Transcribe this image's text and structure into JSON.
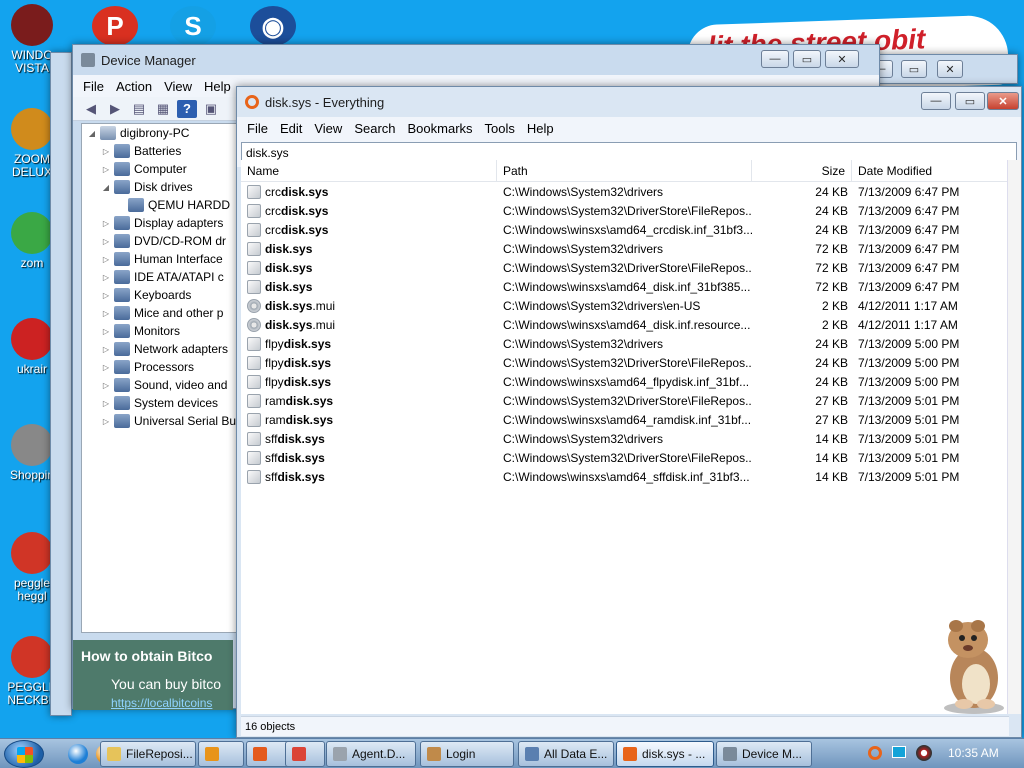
{
  "desktop": {
    "icons": [
      {
        "label": "WINDO\nVISTA",
        "icon": "disc-icon",
        "color": "#7a1c1c"
      },
      {
        "label": "ZOOM\nDELUX",
        "icon": "zoom-icon",
        "color": "#d08b1c"
      },
      {
        "label": "zom",
        "icon": "flower-icon",
        "color": "#3aa845"
      },
      {
        "label": "ukrair",
        "icon": "radiation-icon",
        "color": "#c22"
      },
      {
        "label": "Shoppin",
        "icon": "flash-icon",
        "color": "#888"
      },
      {
        "label": "peggle\nheggl",
        "icon": "peggle-icon",
        "color": "#d03526"
      },
      {
        "label": "PEGGLE\nNECKBE",
        "icon": "peggle-icon",
        "color": "#d03526"
      }
    ],
    "top_icons": [
      {
        "glyph": "P",
        "color": "#d93020"
      },
      {
        "glyph": "S",
        "color": "#14a0e5"
      },
      {
        "glyph": "◉",
        "color": "#1c4e9a"
      }
    ],
    "paper_text": "lit the street obit"
  },
  "device_manager": {
    "title": "Device Manager",
    "menu": [
      "File",
      "Action",
      "View",
      "Help"
    ],
    "tree": [
      {
        "label": "digibrony-PC",
        "arrow": "◢",
        "indent": 0
      },
      {
        "label": "Batteries",
        "arrow": "▷",
        "indent": 1
      },
      {
        "label": "Computer",
        "arrow": "▷",
        "indent": 1
      },
      {
        "label": "Disk drives",
        "arrow": "◢",
        "indent": 1
      },
      {
        "label": "QEMU HARDD",
        "arrow": "",
        "indent": 2
      },
      {
        "label": "Display adapters",
        "arrow": "▷",
        "indent": 1
      },
      {
        "label": "DVD/CD-ROM dr",
        "arrow": "▷",
        "indent": 1
      },
      {
        "label": "Human Interface",
        "arrow": "▷",
        "indent": 1
      },
      {
        "label": "IDE ATA/ATAPI c",
        "arrow": "▷",
        "indent": 1
      },
      {
        "label": "Keyboards",
        "arrow": "▷",
        "indent": 1
      },
      {
        "label": "Mice and other p",
        "arrow": "▷",
        "indent": 1
      },
      {
        "label": "Monitors",
        "arrow": "▷",
        "indent": 1
      },
      {
        "label": "Network adapters",
        "arrow": "▷",
        "indent": 1
      },
      {
        "label": "Processors",
        "arrow": "▷",
        "indent": 1
      },
      {
        "label": "Sound, video and",
        "arrow": "▷",
        "indent": 1
      },
      {
        "label": "System devices",
        "arrow": "▷",
        "indent": 1
      },
      {
        "label": "Universal Serial Bu",
        "arrow": "▷",
        "indent": 1
      }
    ],
    "bottom_heading": "How to obtain Bitco",
    "bottom_text": "You can buy bitco",
    "bottom_link": "https://localbitcoins"
  },
  "everything": {
    "title": "disk.sys - Everything",
    "menu": [
      "File",
      "Edit",
      "View",
      "Search",
      "Bookmarks",
      "Tools",
      "Help"
    ],
    "search_value": "disk.sys",
    "columns": {
      "name": "Name",
      "path": "Path",
      "size": "Size",
      "date": "Date Modified"
    },
    "rows": [
      {
        "pre": "crc",
        "match": "disk.sys",
        "post": "",
        "path": "C:\\Windows\\System32\\drivers",
        "size": "24 KB",
        "date": "7/13/2009 6:47 PM",
        "icon": "file"
      },
      {
        "pre": "crc",
        "match": "disk.sys",
        "post": "",
        "path": "C:\\Windows\\System32\\DriverStore\\FileRepos...",
        "size": "24 KB",
        "date": "7/13/2009 6:47 PM",
        "icon": "file"
      },
      {
        "pre": "crc",
        "match": "disk.sys",
        "post": "",
        "path": "C:\\Windows\\winsxs\\amd64_crcdisk.inf_31bf3...",
        "size": "24 KB",
        "date": "7/13/2009 6:47 PM",
        "icon": "file"
      },
      {
        "pre": "",
        "match": "disk.sys",
        "post": "",
        "path": "C:\\Windows\\System32\\drivers",
        "size": "72 KB",
        "date": "7/13/2009 6:47 PM",
        "icon": "file"
      },
      {
        "pre": "",
        "match": "disk.sys",
        "post": "",
        "path": "C:\\Windows\\System32\\DriverStore\\FileRepos...",
        "size": "72 KB",
        "date": "7/13/2009 6:47 PM",
        "icon": "file"
      },
      {
        "pre": "",
        "match": "disk.sys",
        "post": "",
        "path": "C:\\Windows\\winsxs\\amd64_disk.inf_31bf385...",
        "size": "72 KB",
        "date": "7/13/2009 6:47 PM",
        "icon": "file"
      },
      {
        "pre": "",
        "match": "disk.sys",
        "post": ".mui",
        "path": "C:\\Windows\\System32\\drivers\\en-US",
        "size": "2 KB",
        "date": "4/12/2011 1:17 AM",
        "icon": "gear"
      },
      {
        "pre": "",
        "match": "disk.sys",
        "post": ".mui",
        "path": "C:\\Windows\\winsxs\\amd64_disk.inf.resource...",
        "size": "2 KB",
        "date": "4/12/2011 1:17 AM",
        "icon": "gear"
      },
      {
        "pre": "flpy",
        "match": "disk.sys",
        "post": "",
        "path": "C:\\Windows\\System32\\drivers",
        "size": "24 KB",
        "date": "7/13/2009 5:00 PM",
        "icon": "file"
      },
      {
        "pre": "flpy",
        "match": "disk.sys",
        "post": "",
        "path": "C:\\Windows\\System32\\DriverStore\\FileRepos...",
        "size": "24 KB",
        "date": "7/13/2009 5:00 PM",
        "icon": "file"
      },
      {
        "pre": "flpy",
        "match": "disk.sys",
        "post": "",
        "path": "C:\\Windows\\winsxs\\amd64_flpydisk.inf_31bf...",
        "size": "24 KB",
        "date": "7/13/2009 5:00 PM",
        "icon": "file"
      },
      {
        "pre": "ram",
        "match": "disk.sys",
        "post": "",
        "path": "C:\\Windows\\System32\\DriverStore\\FileRepos...",
        "size": "27 KB",
        "date": "7/13/2009 5:01 PM",
        "icon": "file"
      },
      {
        "pre": "ram",
        "match": "disk.sys",
        "post": "",
        "path": "C:\\Windows\\winsxs\\amd64_ramdisk.inf_31bf...",
        "size": "27 KB",
        "date": "7/13/2009 5:01 PM",
        "icon": "file"
      },
      {
        "pre": "sff",
        "match": "disk.sys",
        "post": "",
        "path": "C:\\Windows\\System32\\drivers",
        "size": "14 KB",
        "date": "7/13/2009 5:01 PM",
        "icon": "file"
      },
      {
        "pre": "sff",
        "match": "disk.sys",
        "post": "",
        "path": "C:\\Windows\\System32\\DriverStore\\FileRepos...",
        "size": "14 KB",
        "date": "7/13/2009 5:01 PM",
        "icon": "file"
      },
      {
        "pre": "sff",
        "match": "disk.sys",
        "post": "",
        "path": "C:\\Windows\\winsxs\\amd64_sffdisk.inf_31bf3...",
        "size": "14 KB",
        "date": "7/13/2009 5:01 PM",
        "icon": "file"
      }
    ],
    "status": "16 objects"
  },
  "taskbar": {
    "quick_launch": [
      {
        "icon": "ie-icon",
        "color": "#1e7fd6"
      },
      {
        "icon": "media-player-icon",
        "color": "#e8941a"
      },
      {
        "icon": "firefox-icon",
        "color": "#e45a1c"
      },
      {
        "icon": "chrome-icon",
        "color": "#db4437"
      }
    ],
    "tasks": [
      {
        "label": "FileReposi...",
        "icon_color": "#e6c35a"
      },
      {
        "label": "",
        "icon_color": "#e8941a"
      },
      {
        "label": "",
        "icon_color": "#e45a1c"
      },
      {
        "label": "",
        "icon_color": "#db4437"
      },
      {
        "label": "Agent.D...",
        "icon_color": "#9aa3ad"
      },
      {
        "label": "Login",
        "icon_color": "#c08a4a"
      },
      {
        "label": "All Data E...",
        "icon_color": "#5a7fb0"
      },
      {
        "label": "disk.sys - ...",
        "icon_color": "#e8641a",
        "active": true
      },
      {
        "label": "Device M...",
        "icon_color": "#7a8a9a"
      }
    ],
    "clock": "10:35 AM"
  }
}
